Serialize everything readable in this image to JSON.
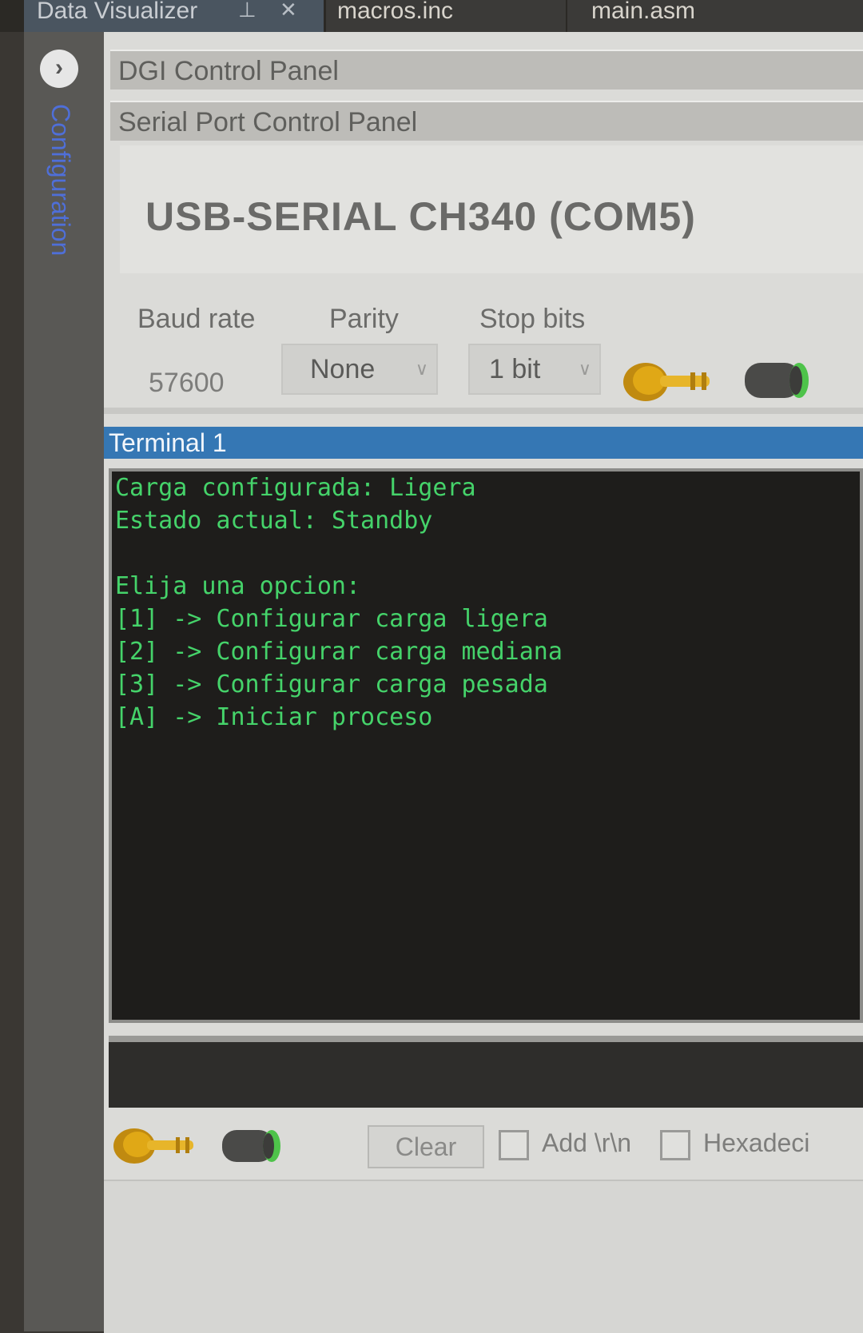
{
  "tabs": {
    "data_visualizer": "Data Visualizer",
    "pin_icon": "pin-icon",
    "close_icon": "close-icon",
    "macros": "macros.inc",
    "main": "main.asm"
  },
  "sidebar": {
    "label": "Configuration",
    "expand_icon": "chevron-right-icon"
  },
  "panels": {
    "dgi": "DGI Control Panel",
    "serial": "Serial Port Control Panel"
  },
  "serial": {
    "device": "USB-SERIAL CH340 (COM5)",
    "baud_label": "Baud rate",
    "parity_label": "Parity",
    "stop_label": "Stop bits",
    "baud_value": "57600",
    "parity_value": "None",
    "stop_value": "1 bit"
  },
  "terminal": {
    "title": "Terminal 1",
    "lines": [
      "Carga configurada: Ligera",
      "Estado actual: Standby",
      "",
      "Elija una opcion:",
      "[1] -> Configurar carga ligera",
      "[2] -> Configurar carga mediana",
      "[3] -> Configurar carga pesada",
      "[A] -> Iniciar proceso"
    ]
  },
  "controls": {
    "clear": "Clear",
    "add_crlf": "Add \\r\\n",
    "hexadecimal": "Hexadeci"
  },
  "colors": {
    "terminal_text": "#45d36a",
    "terminal_bg": "#1e1d1b",
    "title_bar": "#3577b4",
    "connect_plug": "#e0a816",
    "disconnect_plug_ring": "#4ec34a"
  }
}
